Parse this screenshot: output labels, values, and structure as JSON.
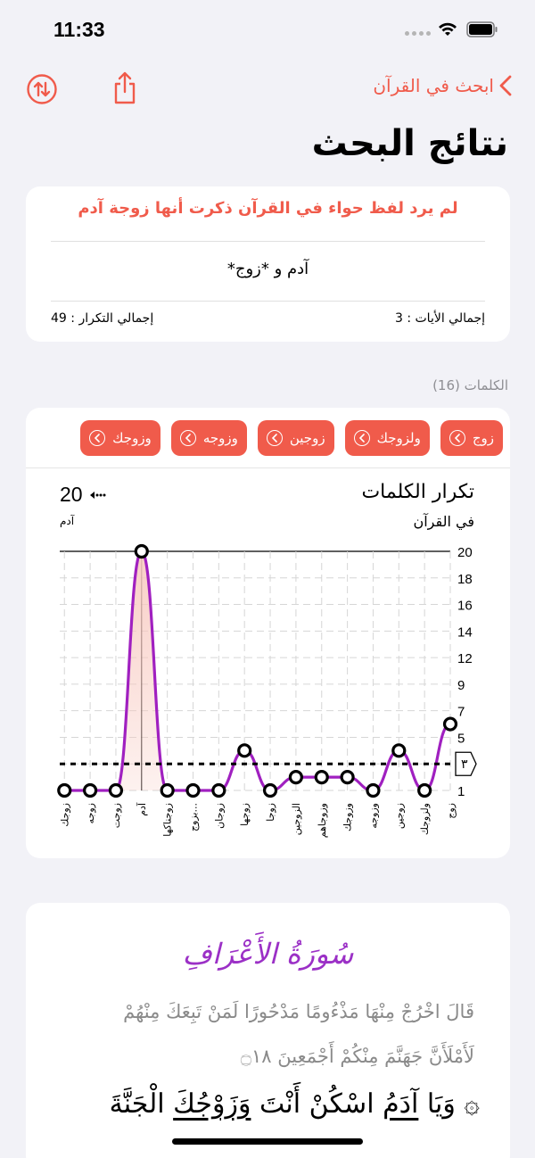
{
  "status": {
    "time": "11:33"
  },
  "nav": {
    "back_label": "ابحث في القرآن"
  },
  "page": {
    "title": "نتائج البحث"
  },
  "summary": {
    "warning": "لم يرد لفظ حواء في القرآن ذكرت أنها زوجة آدم",
    "query": "آدم و *زوج*",
    "total_verses": "إجمالي الأيات : 3",
    "total_repetitions": "إجمالي التكرار : 49"
  },
  "words": {
    "header": "الكلمات (16)",
    "chips": [
      "زوج",
      "ولزوجك",
      "زوجين",
      "وزوجه",
      "وزوجك"
    ]
  },
  "chart": {
    "title": "تكرار الكلمات",
    "subtitle": "في القرآن",
    "max_value": "20",
    "max_label": "آدم",
    "threshold_badge": "٣"
  },
  "chart_data": {
    "type": "line",
    "title": "تكرار الكلمات",
    "subtitle": "في القرآن",
    "categories": [
      "زوج",
      "ولزوجك",
      "زوجين",
      "وزوجه",
      "وزوجك",
      "وزوجاهم",
      "الزوجين",
      "زوجا",
      "زوجها",
      "زوجان",
      "بزوج...",
      "زوجناكها",
      "آدم",
      "زوجت",
      "زوجه",
      "زوجك"
    ],
    "values": [
      6,
      1,
      4,
      1,
      2,
      2,
      2,
      1,
      4,
      1,
      1,
      1,
      20,
      1,
      1,
      1
    ],
    "y_ticks": [
      1,
      3,
      5,
      7,
      9,
      12,
      14,
      16,
      18,
      20
    ],
    "threshold": 3,
    "xlabel": "",
    "ylabel": "",
    "ylim": [
      1,
      20
    ],
    "grid": true,
    "highlight_category": "آدم",
    "line_color": "#a020c0",
    "fill_color": "#f8c9c0"
  },
  "verse": {
    "surah": "سُورَةُ الأَعْرَافِ",
    "line1": "قَالَ اخْرُجْ مِنْهَا مَذْءُومًا مَدْحُورًا لَمَنْ تَبِعَكَ مِنْهُمْ",
    "line2": "لَأَمْلَأَنَّ جَهَنَّمَ مِنْكُمْ أَجْمَعِينَ ۝١٨",
    "line3_pre": "۞ وَيَا ",
    "line3_word1": "آدَمُ",
    "line3_mid": " اسْكُنْ أَنْتَ ",
    "line3_word2": "وَزَوْجُكَ",
    "line3_post": " الْجَنَّةَ"
  },
  "colors": {
    "accent": "#f05b4b",
    "surah": "#9b30c6",
    "background": "#f2f2f7"
  }
}
